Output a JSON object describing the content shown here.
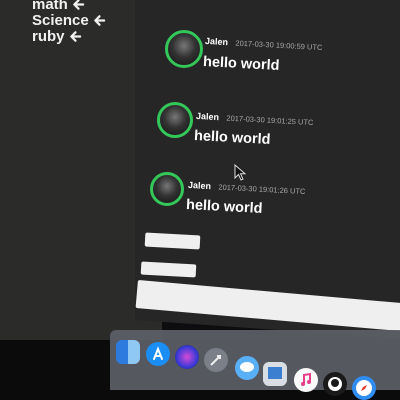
{
  "sidebar": {
    "items": [
      {
        "label": "math",
        "icon": "arrow-left-icon"
      },
      {
        "label": "Science",
        "icon": "arrow-left-icon"
      },
      {
        "label": "ruby",
        "icon": "arrow-left-icon"
      }
    ]
  },
  "messages": [
    {
      "author": "Jalen",
      "timestamp": "2017-03-30 19:00:59 UTC",
      "text": "hello world"
    },
    {
      "author": "Jalen",
      "timestamp": "2017-03-30 19:01:25 UTC",
      "text": "hello world"
    },
    {
      "author": "Jalen",
      "timestamp": "2017-03-30 19:01:26 UTC",
      "text": "hello world"
    }
  ],
  "colors": {
    "avatar_ring": "#34c759",
    "sidebar_bg": "#2b2b2a",
    "main_bg": "#262626"
  },
  "dock": {
    "icons": [
      "finder-icon",
      "app-store-icon",
      "siri-icon",
      "launchpad-icon",
      "messages-icon",
      "preview-icon",
      "itunes-icon",
      "github-icon",
      "safari-icon"
    ]
  }
}
